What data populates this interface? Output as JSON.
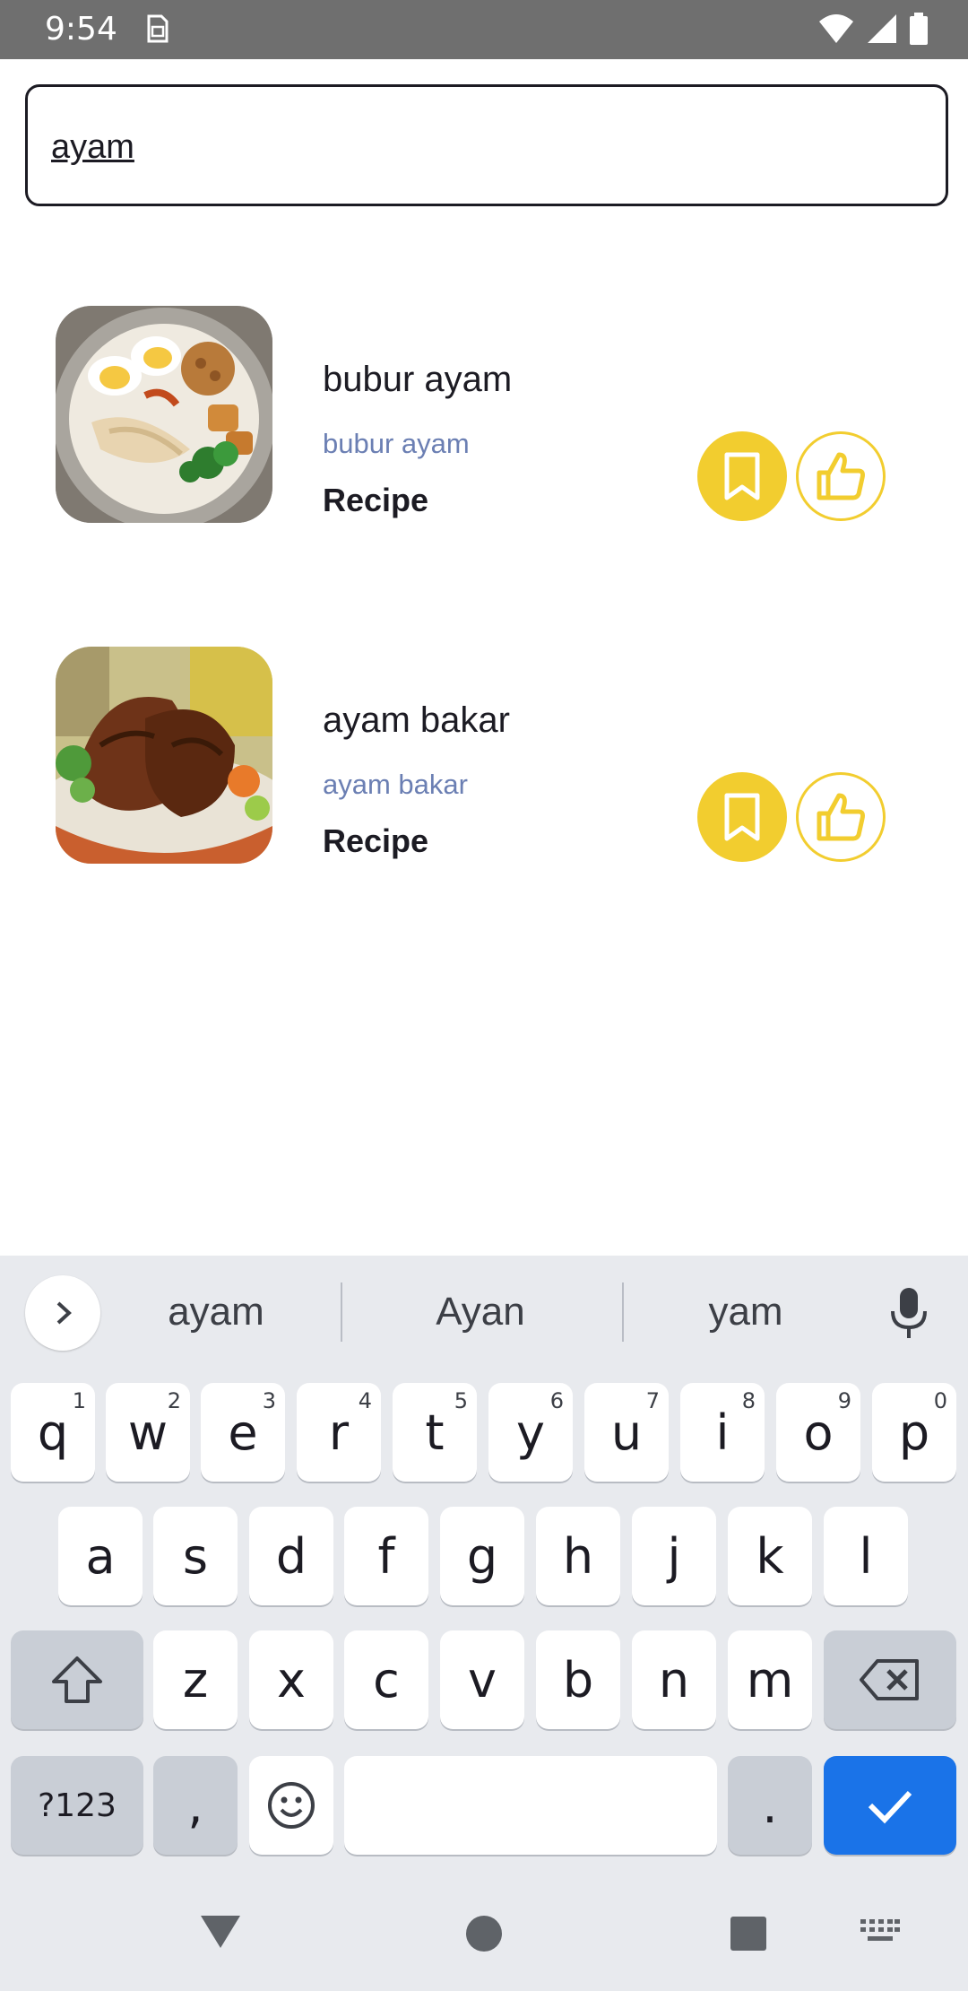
{
  "status_bar": {
    "time": "9:54"
  },
  "search": {
    "value": "ayam"
  },
  "results": [
    {
      "title": "bubur ayam",
      "subtitle": "bubur ayam",
      "kind": "Recipe"
    },
    {
      "title": "ayam bakar",
      "subtitle": "ayam bakar",
      "kind": "Recipe"
    }
  ],
  "keyboard": {
    "suggestions": [
      "ayam",
      "Ayan",
      "yam"
    ],
    "row1": [
      {
        "k": "q",
        "n": "1"
      },
      {
        "k": "w",
        "n": "2"
      },
      {
        "k": "e",
        "n": "3"
      },
      {
        "k": "r",
        "n": "4"
      },
      {
        "k": "t",
        "n": "5"
      },
      {
        "k": "y",
        "n": "6"
      },
      {
        "k": "u",
        "n": "7"
      },
      {
        "k": "i",
        "n": "8"
      },
      {
        "k": "o",
        "n": "9"
      },
      {
        "k": "p",
        "n": "0"
      }
    ],
    "row2": [
      "a",
      "s",
      "d",
      "f",
      "g",
      "h",
      "j",
      "k",
      "l"
    ],
    "row3": [
      "z",
      "x",
      "c",
      "v",
      "b",
      "n",
      "m"
    ],
    "symbols_label": "?123",
    "comma": ",",
    "period": "."
  },
  "colors": {
    "accent_yellow": "#f2cd2f",
    "subtitle_blue": "#6b7fb3",
    "enter_blue": "#1a73e8"
  }
}
